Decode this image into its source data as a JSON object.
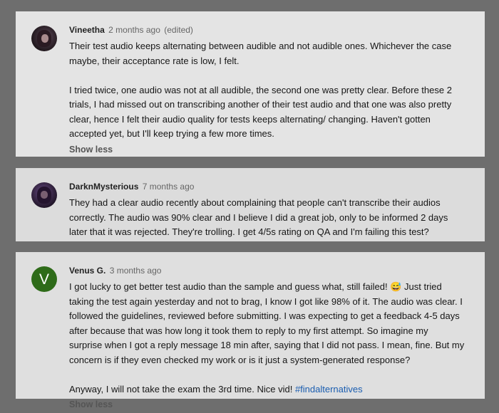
{
  "comments": [
    {
      "author": "Vineetha",
      "time": "2 months ago",
      "edited": "(edited)",
      "paragraphs": [
        [
          "Their test audio keeps alternating between audible and not audible ones. Whichever the case",
          "maybe, their acceptance rate is low, I felt."
        ],
        [
          "I tried twice, one audio was not at all audible, the second one was pretty clear. Before these 2",
          "trials, I had missed out on transcribing another of their test audio and that one was also pretty",
          "clear, hence I felt their audio quality for tests keeps alternating/ changing. Haven't gotten",
          "accepted yet, but I'll keep trying a few more times."
        ]
      ],
      "show_less": "Show less",
      "avatar_icon": "profile-photo-icon"
    },
    {
      "author": "DarknMysterious",
      "time": "7 months ago",
      "paragraphs": [
        [
          "They had a clear audio recently about complaining that people can't transcribe their audios",
          "correctly. The audio was 90% clear and I believe I did a great job, only to be informed 2 days",
          "later that it was rejected. They're trolling. I get 4/5s rating on QA and I'm failing this test?"
        ]
      ],
      "avatar_icon": "profile-photo-icon"
    },
    {
      "author": "Venus G.",
      "time": "3 months ago",
      "avatar_letter": "V",
      "avatar_color": "#2e6b19",
      "paragraphs": [
        [
          "I got lucky to get better test audio than the sample and guess what, still failed! 😅 Just tried",
          "taking the test again yesterday and not to brag, I know I got like 98% of it. The audio was clear. I",
          "followed the guidelines, reviewed before submitting. I was expecting to get a feedback 4-5 days",
          "after because that was how long it took them to reply to my first attempt. So imagine my",
          "surprise when I got a reply message 18 min after, saying that I did not pass. I mean, fine. But my",
          "concern is if they even checked my work or is it just a system-generated response?"
        ]
      ],
      "last_line_text": "Anyway, I will not take the exam the 3rd time. Nice vid! ",
      "hashtag": "#findalternatives",
      "hashtag_color": "#1a5db0",
      "show_less": "Show less"
    }
  ]
}
